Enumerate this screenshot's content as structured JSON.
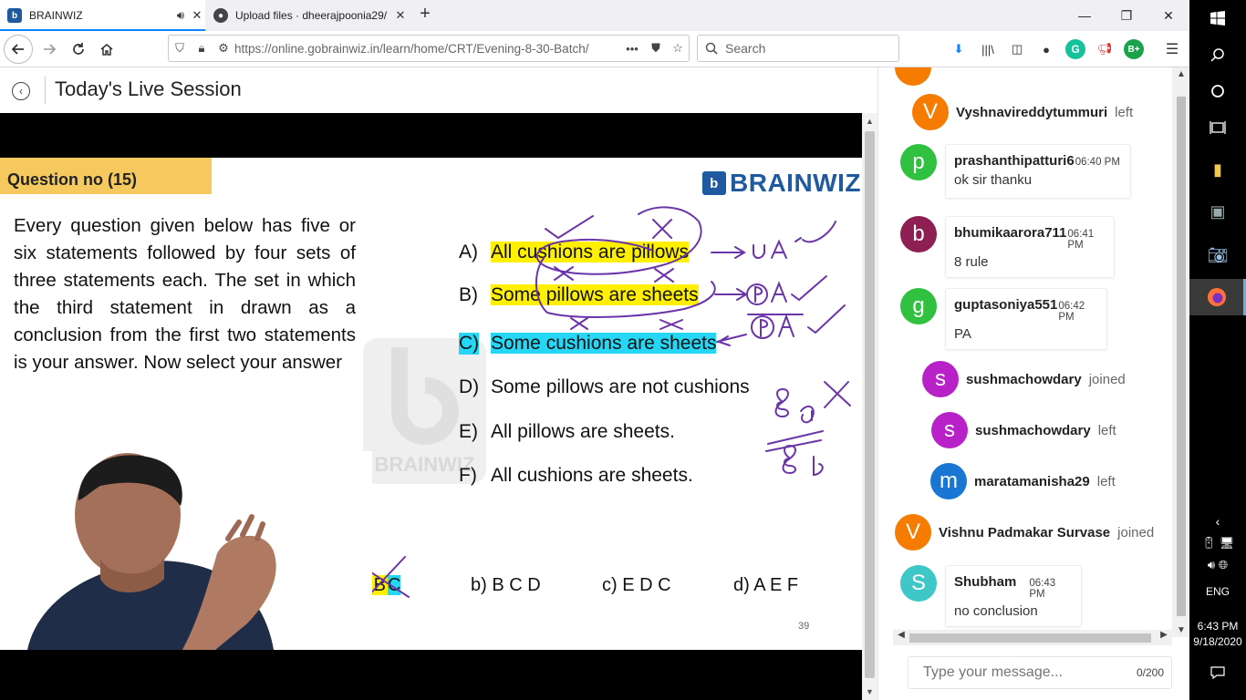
{
  "browser": {
    "tabs": [
      {
        "title": "BRAINWIZ",
        "favicon": "brainwiz-b",
        "sound_icon": "speaker-icon",
        "close": "✕"
      },
      {
        "title": "Upload files · dheerajpoonia29/",
        "favicon": "github-icon",
        "close": "✕"
      }
    ],
    "new_tab": "+",
    "window_controls": {
      "minimize": "—",
      "maximize": "❐",
      "close": "✕"
    },
    "url": "https://online.gobrainwiz.in/learn/home/CRT/Evening-8-30-Batch/",
    "url_more": "•••",
    "search_placeholder": "Search",
    "accent": "#0a84ff"
  },
  "page": {
    "title": "Today's Live Session"
  },
  "slide": {
    "question_no": "Question no (15)",
    "logo_text": "BRAINWIZ",
    "watermark": "BRAINWIZ",
    "question_text": "Every question given below has five or six statements followed by four sets of three statements each. The set in which the third statement in drawn as a conclusion from the first two statements is your answer. Now select your answer",
    "options": [
      {
        "letter": "A)",
        "text": "All cushions are pillows"
      },
      {
        "letter": "B)",
        "text": "Some pillows are sheets"
      },
      {
        "letter": "C)",
        "text": "Some cushions are sheets"
      },
      {
        "letter": "D)",
        "text": "Some pillows are not cushions"
      },
      {
        "letter": "E)",
        "text": "All pillows are sheets."
      },
      {
        "letter": "F)",
        "text": "All cushions are sheets."
      }
    ],
    "answers": {
      "a_prefix": "a) ",
      "a_A": "A",
      "a_B": "B",
      "a_C": "C",
      "b": "b) B C D",
      "c": "c) E D C",
      "d": "d) A E F"
    },
    "page_number": "39",
    "highlight_yellow": "#ffef00",
    "highlight_cyan": "#25d6f5",
    "ink_color": "#6a35a8"
  },
  "chat": {
    "events": [
      {
        "initial": "V",
        "name": "Vyshnavireddytummuri",
        "status": "left",
        "color": "#f57c00"
      },
      {
        "initial": "s",
        "name": "sushmachowdary",
        "status": "joined",
        "color": "#b820c8"
      },
      {
        "initial": "s",
        "name": "sushmachowdary",
        "status": "left",
        "color": "#b820c8"
      },
      {
        "initial": "m",
        "name": "maratamanisha29",
        "status": "left",
        "color": "#1976d2"
      },
      {
        "initial": "V",
        "name": "Vishnu Padmakar Survase",
        "status": "joined",
        "color": "#f57c00"
      }
    ],
    "messages": [
      {
        "initial": "p",
        "name": "prashanthipatturi6",
        "time": "06:40 PM",
        "text": "ok sir thanku",
        "color": "#2fc13f"
      },
      {
        "initial": "b",
        "name": "bhumikaarora711",
        "time": "06:41 PM",
        "text": "8 rule",
        "color": "#8e1f52"
      },
      {
        "initial": "g",
        "name": "guptasoniya551",
        "time": "06:42 PM",
        "text": "PA",
        "color": "#2fc13f"
      },
      {
        "initial": "S",
        "name": "Shubham",
        "time": "06:43 PM",
        "text": "no conclusion",
        "color": "#3fc6c6"
      }
    ],
    "input_placeholder": "Type your message...",
    "char_count": "0/200"
  },
  "taskbar": {
    "language": "ENG",
    "time": "6:43 PM",
    "date": "9/18/2020"
  }
}
